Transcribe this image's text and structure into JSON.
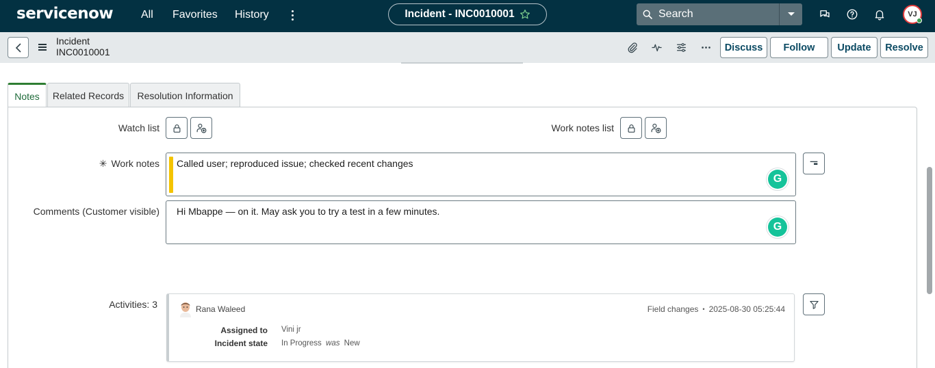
{
  "topbar": {
    "logo": "servicenow",
    "nav": [
      "All",
      "Favorites",
      "History"
    ],
    "record_pill": "Incident - INC0010001",
    "search_label": "Search",
    "avatar_initials": "VJ",
    "bg_color": "#033142"
  },
  "subbar": {
    "record_type": "Incident",
    "record_number": "INC0010001",
    "buttons": {
      "discuss": "Discuss",
      "follow": "Follow",
      "update": "Update",
      "resolve": "Resolve"
    }
  },
  "tabs": [
    "Notes",
    "Related Records",
    "Resolution Information"
  ],
  "form": {
    "watch_list_label": "Watch list",
    "work_notes_list_label": "Work notes list",
    "required_mark": "✳",
    "work_notes_label": "Work notes",
    "work_notes_value": "Called user; reproduced issue; checked recent changes",
    "comments_label": "Comments (Customer visible)",
    "comments_value": "Hi Mbappe — on it. May ask you to try a test in a few minutes.",
    "grammarly_glyph": "G"
  },
  "activities": {
    "label": "Activities: 3",
    "entry": {
      "author": "Rana Waleed",
      "type": "Field changes",
      "separator": "•",
      "timestamp": "2025-08-30 05:25:44",
      "fields": [
        {
          "name": "Assigned to",
          "value": "Vini jr",
          "was_word": "",
          "old_value": ""
        },
        {
          "name": "Incident state",
          "value": "In Progress",
          "was_word": "was",
          "old_value": "New"
        }
      ]
    }
  }
}
